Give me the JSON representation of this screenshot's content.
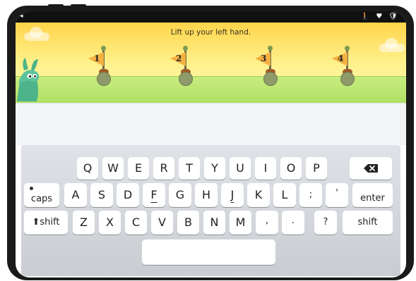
{
  "app": {
    "instruction": "Lift up your left hand."
  },
  "status_icons": [
    "🚶",
    "♥",
    "🛡"
  ],
  "flags": [
    {
      "number": "1"
    },
    {
      "number": "2"
    },
    {
      "number": "3"
    },
    {
      "number": "4"
    }
  ],
  "keyboard": {
    "row1": [
      "Q",
      "W",
      "E",
      "R",
      "T",
      "Y",
      "U",
      "I",
      "O",
      "P"
    ],
    "row2": [
      "A",
      "S",
      "D",
      "F",
      "G",
      "H",
      "J",
      "K",
      "L",
      ";",
      "'"
    ],
    "row3": [
      "Z",
      "X",
      "C",
      "V",
      "B",
      "N",
      "M",
      ",",
      ".",
      "?"
    ],
    "caps_label": "caps",
    "enter_label": "enter",
    "shift_left_label": "shift",
    "shift_right_label": "shift"
  },
  "colors": {
    "sky": "#ffd44a",
    "grass": "#c8ec80",
    "flag": "#f4b040",
    "device": "#1a1a1a"
  }
}
